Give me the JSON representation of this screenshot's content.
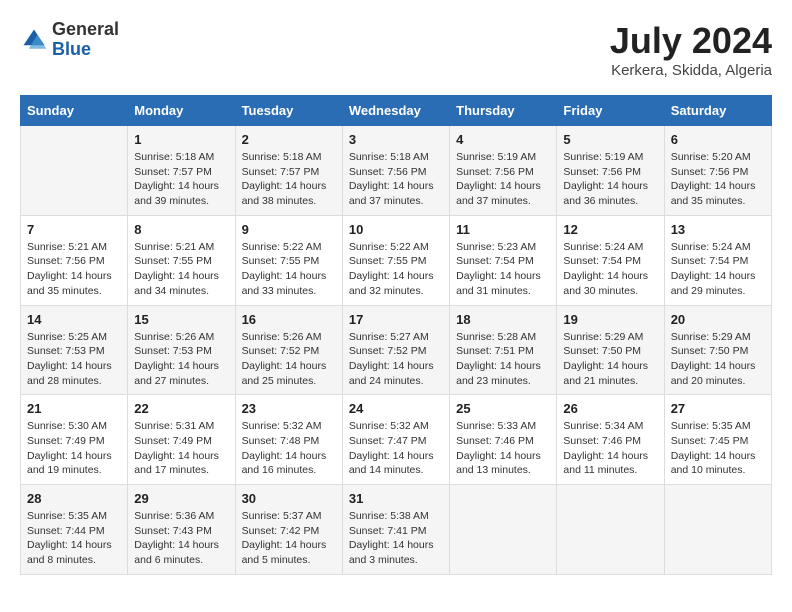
{
  "logo": {
    "general": "General",
    "blue": "Blue"
  },
  "title": {
    "month_year": "July 2024",
    "location": "Kerkera, Skidda, Algeria"
  },
  "headers": [
    "Sunday",
    "Monday",
    "Tuesday",
    "Wednesday",
    "Thursday",
    "Friday",
    "Saturday"
  ],
  "weeks": [
    [
      {
        "day": "",
        "info": ""
      },
      {
        "day": "1",
        "info": "Sunrise: 5:18 AM\nSunset: 7:57 PM\nDaylight: 14 hours\nand 39 minutes."
      },
      {
        "day": "2",
        "info": "Sunrise: 5:18 AM\nSunset: 7:57 PM\nDaylight: 14 hours\nand 38 minutes."
      },
      {
        "day": "3",
        "info": "Sunrise: 5:18 AM\nSunset: 7:56 PM\nDaylight: 14 hours\nand 37 minutes."
      },
      {
        "day": "4",
        "info": "Sunrise: 5:19 AM\nSunset: 7:56 PM\nDaylight: 14 hours\nand 37 minutes."
      },
      {
        "day": "5",
        "info": "Sunrise: 5:19 AM\nSunset: 7:56 PM\nDaylight: 14 hours\nand 36 minutes."
      },
      {
        "day": "6",
        "info": "Sunrise: 5:20 AM\nSunset: 7:56 PM\nDaylight: 14 hours\nand 35 minutes."
      }
    ],
    [
      {
        "day": "7",
        "info": "Sunrise: 5:21 AM\nSunset: 7:56 PM\nDaylight: 14 hours\nand 35 minutes."
      },
      {
        "day": "8",
        "info": "Sunrise: 5:21 AM\nSunset: 7:55 PM\nDaylight: 14 hours\nand 34 minutes."
      },
      {
        "day": "9",
        "info": "Sunrise: 5:22 AM\nSunset: 7:55 PM\nDaylight: 14 hours\nand 33 minutes."
      },
      {
        "day": "10",
        "info": "Sunrise: 5:22 AM\nSunset: 7:55 PM\nDaylight: 14 hours\nand 32 minutes."
      },
      {
        "day": "11",
        "info": "Sunrise: 5:23 AM\nSunset: 7:54 PM\nDaylight: 14 hours\nand 31 minutes."
      },
      {
        "day": "12",
        "info": "Sunrise: 5:24 AM\nSunset: 7:54 PM\nDaylight: 14 hours\nand 30 minutes."
      },
      {
        "day": "13",
        "info": "Sunrise: 5:24 AM\nSunset: 7:54 PM\nDaylight: 14 hours\nand 29 minutes."
      }
    ],
    [
      {
        "day": "14",
        "info": "Sunrise: 5:25 AM\nSunset: 7:53 PM\nDaylight: 14 hours\nand 28 minutes."
      },
      {
        "day": "15",
        "info": "Sunrise: 5:26 AM\nSunset: 7:53 PM\nDaylight: 14 hours\nand 27 minutes."
      },
      {
        "day": "16",
        "info": "Sunrise: 5:26 AM\nSunset: 7:52 PM\nDaylight: 14 hours\nand 25 minutes."
      },
      {
        "day": "17",
        "info": "Sunrise: 5:27 AM\nSunset: 7:52 PM\nDaylight: 14 hours\nand 24 minutes."
      },
      {
        "day": "18",
        "info": "Sunrise: 5:28 AM\nSunset: 7:51 PM\nDaylight: 14 hours\nand 23 minutes."
      },
      {
        "day": "19",
        "info": "Sunrise: 5:29 AM\nSunset: 7:50 PM\nDaylight: 14 hours\nand 21 minutes."
      },
      {
        "day": "20",
        "info": "Sunrise: 5:29 AM\nSunset: 7:50 PM\nDaylight: 14 hours\nand 20 minutes."
      }
    ],
    [
      {
        "day": "21",
        "info": "Sunrise: 5:30 AM\nSunset: 7:49 PM\nDaylight: 14 hours\nand 19 minutes."
      },
      {
        "day": "22",
        "info": "Sunrise: 5:31 AM\nSunset: 7:49 PM\nDaylight: 14 hours\nand 17 minutes."
      },
      {
        "day": "23",
        "info": "Sunrise: 5:32 AM\nSunset: 7:48 PM\nDaylight: 14 hours\nand 16 minutes."
      },
      {
        "day": "24",
        "info": "Sunrise: 5:32 AM\nSunset: 7:47 PM\nDaylight: 14 hours\nand 14 minutes."
      },
      {
        "day": "25",
        "info": "Sunrise: 5:33 AM\nSunset: 7:46 PM\nDaylight: 14 hours\nand 13 minutes."
      },
      {
        "day": "26",
        "info": "Sunrise: 5:34 AM\nSunset: 7:46 PM\nDaylight: 14 hours\nand 11 minutes."
      },
      {
        "day": "27",
        "info": "Sunrise: 5:35 AM\nSunset: 7:45 PM\nDaylight: 14 hours\nand 10 minutes."
      }
    ],
    [
      {
        "day": "28",
        "info": "Sunrise: 5:35 AM\nSunset: 7:44 PM\nDaylight: 14 hours\nand 8 minutes."
      },
      {
        "day": "29",
        "info": "Sunrise: 5:36 AM\nSunset: 7:43 PM\nDaylight: 14 hours\nand 6 minutes."
      },
      {
        "day": "30",
        "info": "Sunrise: 5:37 AM\nSunset: 7:42 PM\nDaylight: 14 hours\nand 5 minutes."
      },
      {
        "day": "31",
        "info": "Sunrise: 5:38 AM\nSunset: 7:41 PM\nDaylight: 14 hours\nand 3 minutes."
      },
      {
        "day": "",
        "info": ""
      },
      {
        "day": "",
        "info": ""
      },
      {
        "day": "",
        "info": ""
      }
    ]
  ]
}
